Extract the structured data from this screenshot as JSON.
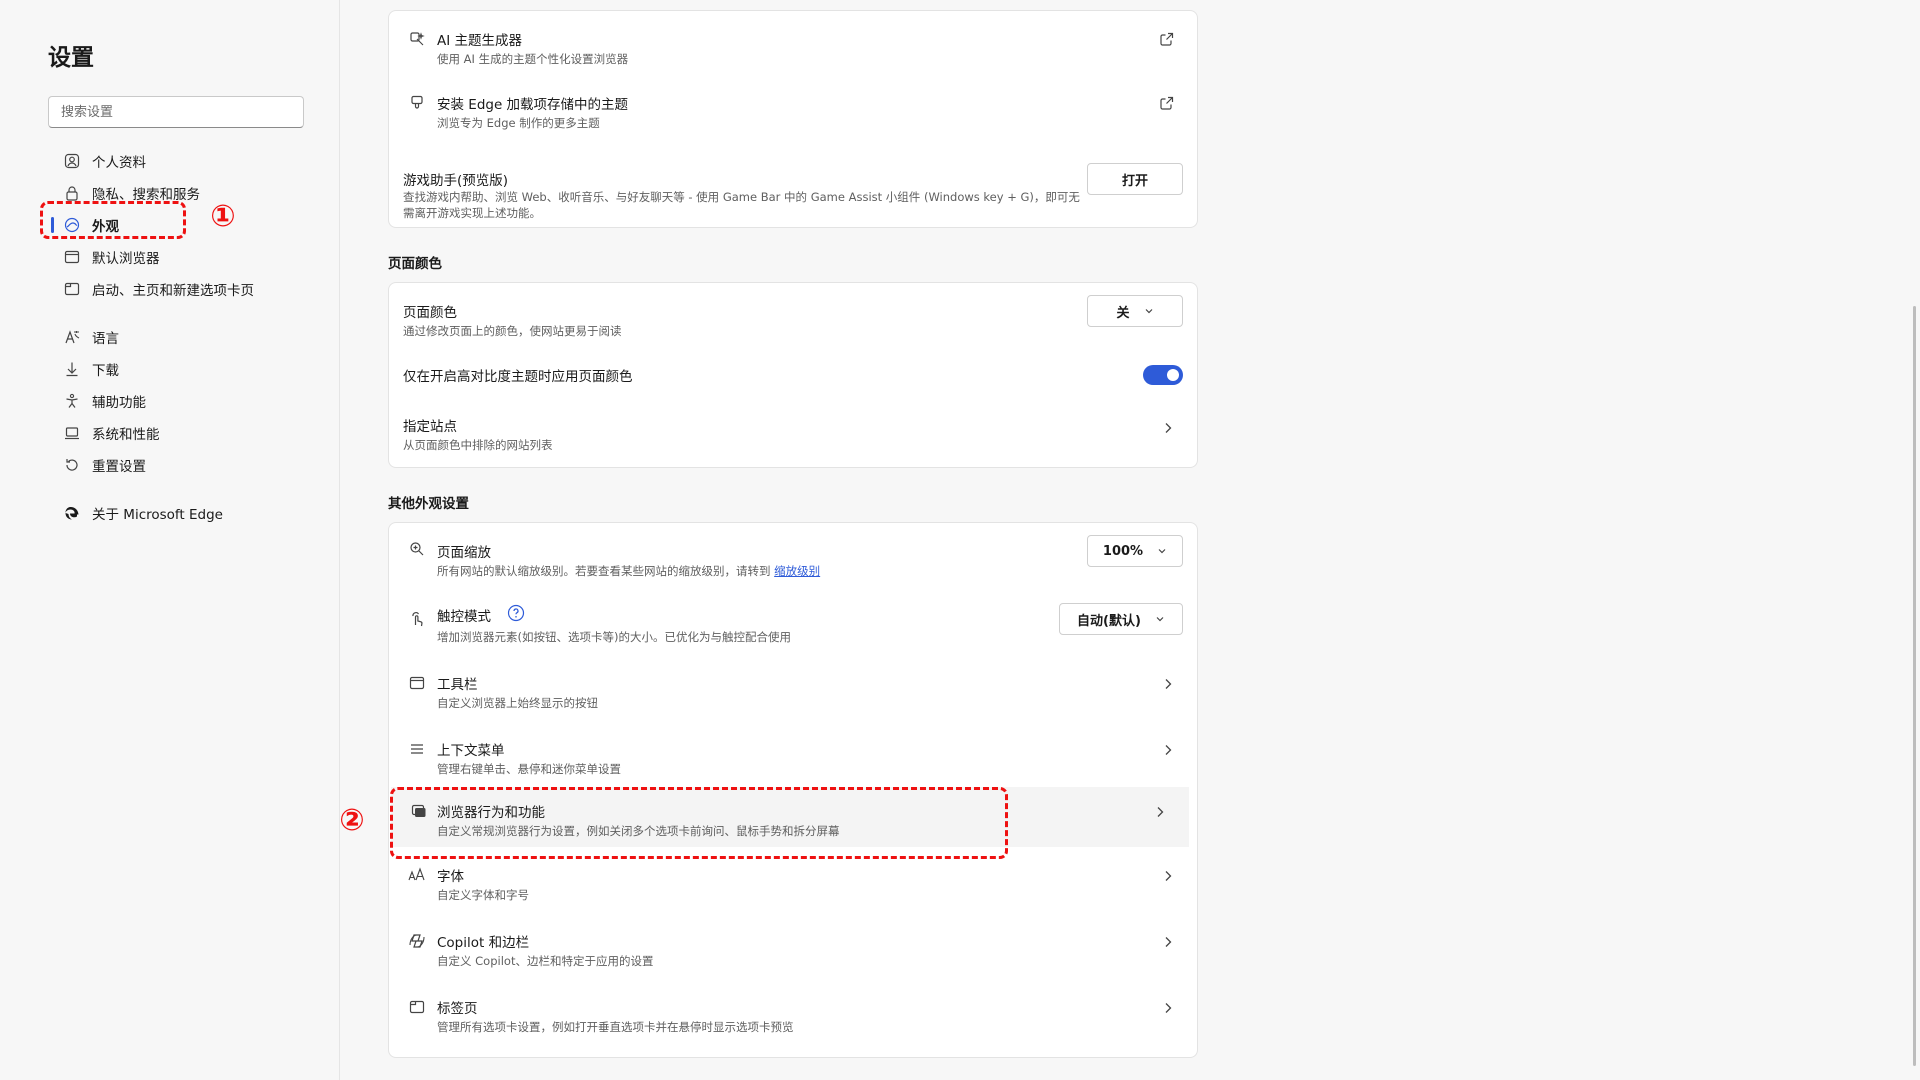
{
  "sidebar": {
    "title": "设置",
    "search_placeholder": "搜索设置",
    "items": [
      {
        "label": "个人资料",
        "icon": "profile-icon"
      },
      {
        "label": "隐私、搜索和服务",
        "icon": "lock-icon"
      },
      {
        "label": "外观",
        "icon": "appearance-icon",
        "active": true
      },
      {
        "label": "默认浏览器",
        "icon": "browser-icon"
      },
      {
        "label": "启动、主页和新建选项卡页",
        "icon": "home-tab-icon"
      },
      {
        "label": "语言",
        "icon": "language-icon"
      },
      {
        "label": "下载",
        "icon": "download-icon"
      },
      {
        "label": "辅助功能",
        "icon": "accessibility-icon"
      },
      {
        "label": "系统和性能",
        "icon": "laptop-icon"
      },
      {
        "label": "重置设置",
        "icon": "reset-icon"
      },
      {
        "label": "关于 Microsoft Edge",
        "icon": "edge-logo-icon"
      }
    ]
  },
  "annotations": {
    "one": "①",
    "two": "②"
  },
  "theme_card": {
    "ai_theme": {
      "title": "AI 主题生成器",
      "desc": "使用 AI 生成的主题个性化设置浏览器"
    },
    "edge_addon": {
      "title": "安装 Edge 加载项存储中的主题",
      "desc": "浏览专为 Edge 制作的更多主题"
    },
    "game_assist": {
      "title": "游戏助手(预览版)",
      "desc": "查找游戏内帮助、浏览 Web、收听音乐、与好友聊天等 - 使用 Game Bar 中的 Game Assist 小组件 (Windows key + G)，即可无需离开游戏实现上述功能。",
      "button": "打开"
    }
  },
  "page_color_section": {
    "label": "页面颜色",
    "page_color": {
      "title": "页面颜色",
      "desc": "通过修改页面上的颜色，使网站更易于阅读",
      "value": "关"
    },
    "high_contrast": {
      "title": "仅在开启高对比度主题时应用页面颜色",
      "enabled": true
    },
    "sites": {
      "title": "指定站点",
      "desc": "从页面颜色中排除的网站列表"
    }
  },
  "other_section": {
    "label": "其他外观设置",
    "zoom": {
      "title": "页面缩放",
      "desc": "所有网站的默认缩放级别。若要查看某些网站的缩放级别，请转到",
      "link": "缩放级别",
      "value": "100%"
    },
    "touch": {
      "title": "触控模式",
      "desc": "增加浏览器元素(如按钮、选项卡等)的大小。已优化为与触控配合使用",
      "value": "自动(默认)"
    },
    "toolbar": {
      "title": "工具栏",
      "desc": "自定义浏览器上始终显示的按钮"
    },
    "context_menu": {
      "title": "上下文菜单",
      "desc": "管理右键单击、悬停和迷你菜单设置"
    },
    "browser_behavior": {
      "title": "浏览器行为和功能",
      "desc": "自定义常规浏览器行为设置，例如关闭多个选项卡前询问、鼠标手势和拆分屏幕"
    },
    "fonts": {
      "title": "字体",
      "desc": "自定义字体和字号"
    },
    "copilot": {
      "title": "Copilot 和边栏",
      "desc": "自定义 Copilot、边栏和特定于应用的设置"
    },
    "tabs": {
      "title": "标签页",
      "desc": "管理所有选项卡设置，例如打开垂直选项卡并在悬停时显示选项卡预览"
    }
  },
  "colors": {
    "accent": "#2e5bd8",
    "annotation": "#ee1111"
  }
}
